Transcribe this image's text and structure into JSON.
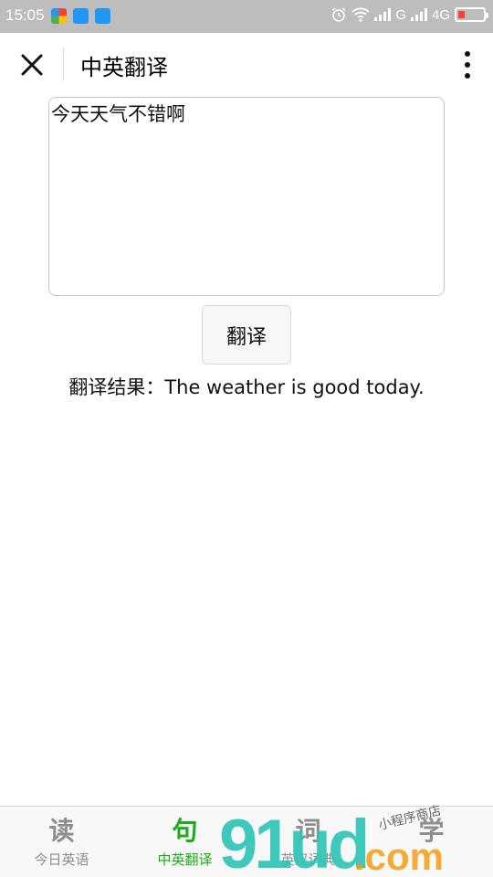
{
  "status_bar": {
    "time": "15:05",
    "network_1": "G",
    "network_2": "4G",
    "battery_level": 0.25,
    "battery_color": "#f44336"
  },
  "nav": {
    "title": "中英翻译"
  },
  "input": {
    "value": "今天天气不错啊"
  },
  "translate_button": {
    "label": "翻译"
  },
  "result": {
    "text": "翻译结果：The weather is good today."
  },
  "tabs": [
    {
      "icon_char": "读",
      "label": "今日英语",
      "active": false
    },
    {
      "icon_char": "句",
      "label": "中英翻译",
      "active": true
    },
    {
      "icon_char": "词",
      "label": "英汉词典",
      "active": false
    },
    {
      "icon_char": "学",
      "label": "",
      "active": false
    }
  ],
  "watermark": {
    "text_logo": "91ud",
    "text_suffix": ".com",
    "text_small": "小程序商店"
  },
  "colors": {
    "accent": "#1aad19",
    "inactive": "#8e8e8e",
    "statusbar": "#bdbdbd"
  }
}
